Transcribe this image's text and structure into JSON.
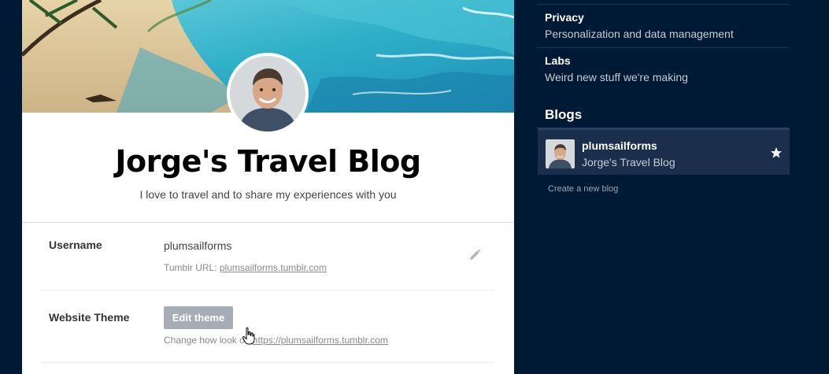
{
  "blog": {
    "title": "Jorge's Travel Blog",
    "description": "I love to travel and to share my experiences with you"
  },
  "settings": {
    "username_label": "Username",
    "username_value": "plumsailforms",
    "tumblr_url_prefix": "Tumblr URL: ",
    "tumblr_url": "plumsailforms.tumblr.com",
    "theme_label": "Website Theme",
    "edit_theme_button": "Edit theme",
    "theme_sub_prefix": "Change how",
    "theme_sub_middle": " look on ",
    "theme_url": "https://plumsailforms.tumblr.com"
  },
  "sidebar": {
    "items": [
      {
        "title": "Privacy",
        "subtitle": "Personalization and data management"
      },
      {
        "title": "Labs",
        "subtitle": "Weird new stuff we're making"
      }
    ],
    "blogs_heading": "Blogs",
    "blog_entry": {
      "name": "plumsailforms",
      "title": "Jorge's Travel Blog"
    },
    "create_blog_link": "Create a new blog"
  },
  "icons": {
    "edit": "pencil-icon",
    "favorite": "star-icon",
    "cursor": "hand-pointer-cursor"
  },
  "colors": {
    "sidebar_bg": "#001935",
    "blog_entry_bg": "#1b2f4d",
    "button_bg": "#a7adb6"
  }
}
